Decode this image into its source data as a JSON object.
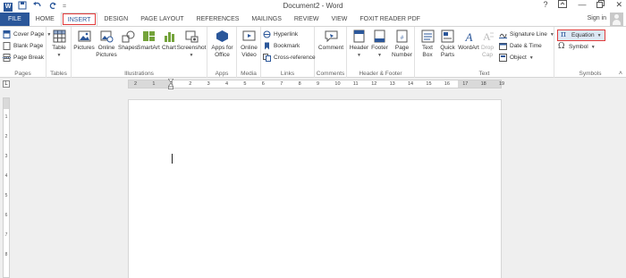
{
  "window": {
    "title": "Document2 - Word",
    "help": "?",
    "sign_in": "Sign in"
  },
  "qat": {
    "save": "save-icon",
    "undo": "undo-icon",
    "redo": "redo-icon",
    "customize": "="
  },
  "tabs": [
    "FILE",
    "HOME",
    "INSERT",
    "DESIGN",
    "PAGE LAYOUT",
    "REFERENCES",
    "MAILINGS",
    "REVIEW",
    "VIEW",
    "FOXIT READER PDF"
  ],
  "active_tab": "INSERT",
  "ribbon": {
    "pages": {
      "label": "Pages",
      "cover_page": "Cover Page",
      "blank_page": "Blank Page",
      "page_break": "Page Break"
    },
    "tables": {
      "label": "Tables",
      "table": "Table"
    },
    "illustrations": {
      "label": "Illustrations",
      "pictures": "Pictures",
      "online_pictures": "Online Pictures",
      "shapes": "Shapes",
      "smartart": "SmartArt",
      "chart": "Chart",
      "screenshot": "Screenshot"
    },
    "apps": {
      "label": "Apps",
      "apps_for_office": "Apps for Office"
    },
    "media": {
      "label": "Media",
      "online_video": "Online Video"
    },
    "links": {
      "label": "Links",
      "hyperlink": "Hyperlink",
      "bookmark": "Bookmark",
      "cross_reference": "Cross-reference"
    },
    "comments": {
      "label": "Comments",
      "comment": "Comment"
    },
    "header_footer": {
      "label": "Header & Footer",
      "header": "Header",
      "footer": "Footer",
      "page_number": "Page Number"
    },
    "text": {
      "label": "Text",
      "text_box": "Text Box",
      "quick_parts": "Quick Parts",
      "wordart": "WordArt",
      "drop_cap": "Drop Cap",
      "signature_line": "Signature Line",
      "date_time": "Date & Time",
      "object": "Object"
    },
    "symbols": {
      "label": "Symbols",
      "equation": "Equation",
      "symbol": "Symbol"
    }
  },
  "ruler": {
    "corner": "L",
    "numbers": [
      "2",
      "1",
      "1",
      "2",
      "3",
      "4",
      "5",
      "6",
      "7",
      "8",
      "9",
      "10",
      "11",
      "12",
      "13",
      "14",
      "15",
      "16",
      "17",
      "18",
      "19"
    ]
  },
  "vruler": {
    "numbers": [
      "1",
      "2",
      "3",
      "4",
      "5",
      "6",
      "7",
      "8"
    ]
  },
  "colors": {
    "accent": "#2b579a",
    "highlight": "#e03b3b"
  }
}
